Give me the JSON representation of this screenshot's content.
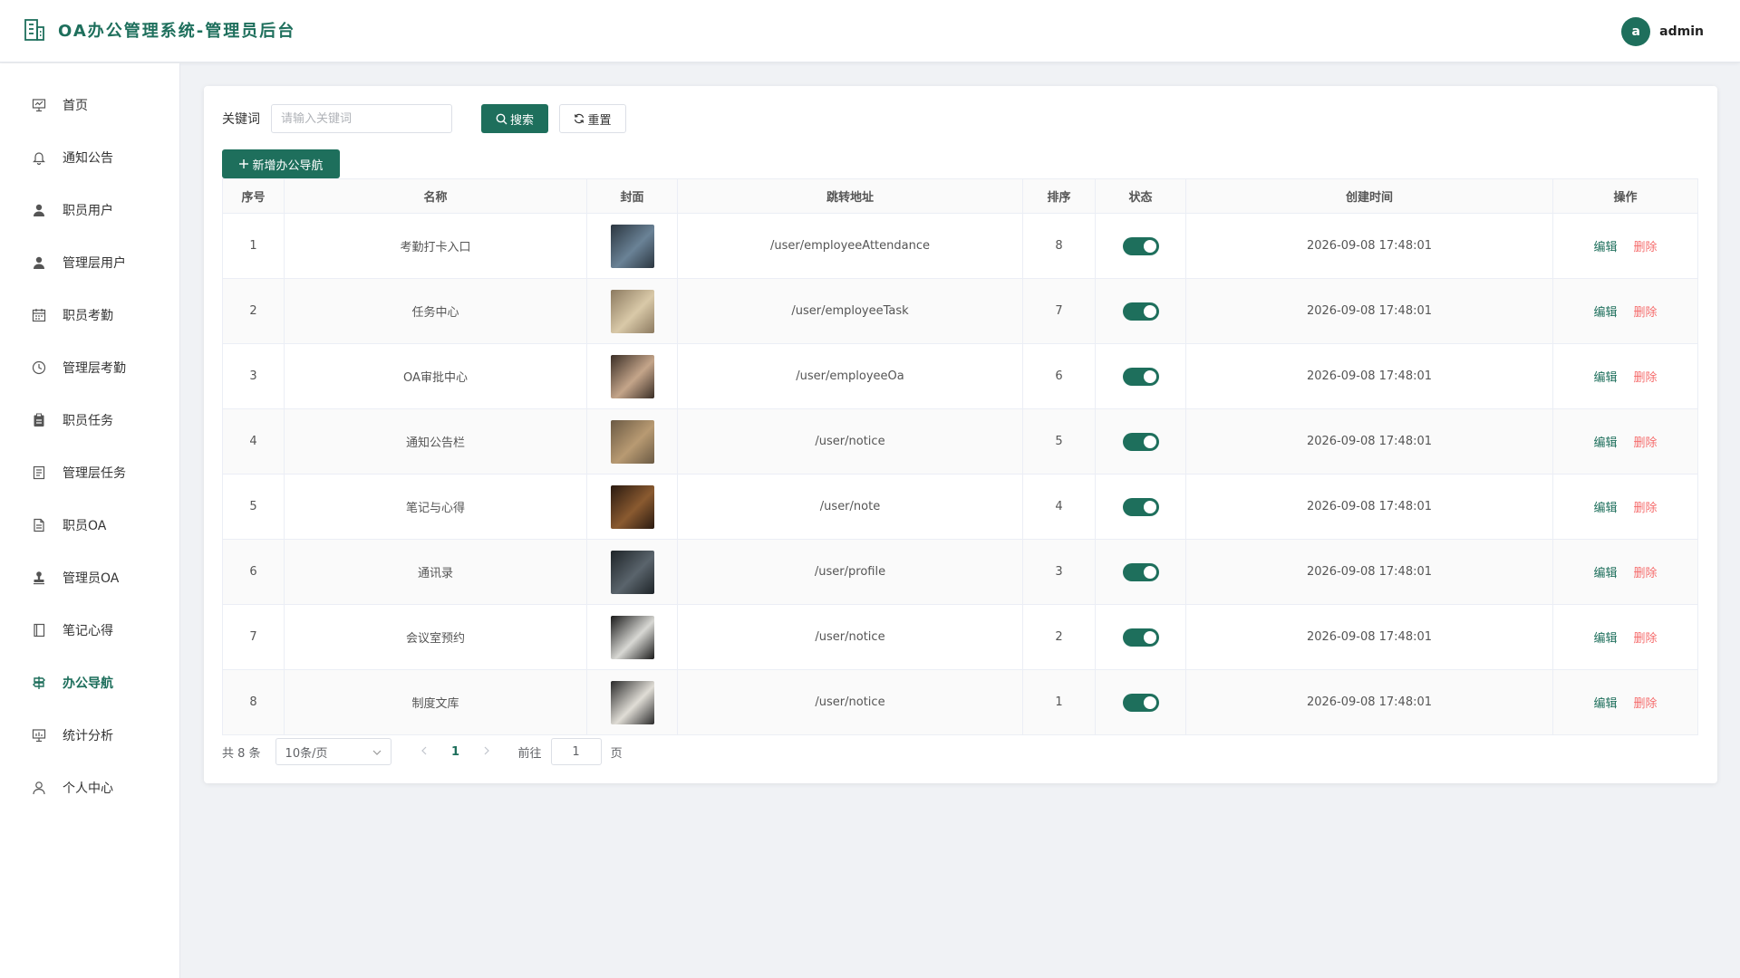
{
  "header": {
    "title": "OA办公管理系统-管理员后台",
    "avatar_letter": "a",
    "username": "admin"
  },
  "sidebar": {
    "items": [
      {
        "label": "首页",
        "icon": "presentation-icon",
        "active": false
      },
      {
        "label": "通知公告",
        "icon": "bell-icon",
        "active": false
      },
      {
        "label": "职员用户",
        "icon": "user-icon",
        "active": false
      },
      {
        "label": "管理层用户",
        "icon": "user-icon",
        "active": false
      },
      {
        "label": "职员考勤",
        "icon": "calendar-icon",
        "active": false
      },
      {
        "label": "管理层考勤",
        "icon": "clock-icon",
        "active": false
      },
      {
        "label": "职员任务",
        "icon": "clipboard-icon",
        "active": false
      },
      {
        "label": "管理层任务",
        "icon": "document-icon",
        "active": false
      },
      {
        "label": "职员OA",
        "icon": "file-icon",
        "active": false
      },
      {
        "label": "管理员OA",
        "icon": "stamp-icon",
        "active": false
      },
      {
        "label": "笔记心得",
        "icon": "notebook-icon",
        "active": false
      },
      {
        "label": "办公导航",
        "icon": "signpost-icon",
        "active": true
      },
      {
        "label": "统计分析",
        "icon": "chart-board-icon",
        "active": false
      },
      {
        "label": "个人中心",
        "icon": "person-outline-icon",
        "active": false
      }
    ]
  },
  "search": {
    "label": "关键词",
    "placeholder": "请输入关键词",
    "search_button": "搜索",
    "reset_button": "重置"
  },
  "toolbar": {
    "add_button": "新增办公导航"
  },
  "table": {
    "headers": [
      "序号",
      "名称",
      "封面",
      "跳转地址",
      "排序",
      "状态",
      "创建时间",
      "操作"
    ],
    "rows": [
      {
        "index": "1",
        "name": "考勤打卡入口",
        "url": "/user/employeeAttendance",
        "sort": "8",
        "status": true,
        "created": "2026-09-08 17:48:01",
        "cover_colors": [
          "#2b3640",
          "#6a8296"
        ]
      },
      {
        "index": "2",
        "name": "任务中心",
        "url": "/user/employeeTask",
        "sort": "7",
        "status": true,
        "created": "2026-09-08 17:48:01",
        "cover_colors": [
          "#8c7a60",
          "#d9c9a8"
        ]
      },
      {
        "index": "3",
        "name": "OA审批中心",
        "url": "/user/employeeOa",
        "sort": "6",
        "status": true,
        "created": "2026-09-08 17:48:01",
        "cover_colors": [
          "#3a2e26",
          "#c4a58a"
        ]
      },
      {
        "index": "4",
        "name": "通知公告栏",
        "url": "/user/notice",
        "sort": "5",
        "status": true,
        "created": "2026-09-08 17:48:01",
        "cover_colors": [
          "#6b5a44",
          "#b89a72"
        ]
      },
      {
        "index": "5",
        "name": "笔记与心得",
        "url": "/user/note",
        "sort": "4",
        "status": true,
        "created": "2026-09-08 17:48:01",
        "cover_colors": [
          "#2a1a10",
          "#8a5a30"
        ]
      },
      {
        "index": "6",
        "name": "通讯录",
        "url": "/user/profile",
        "sort": "3",
        "status": true,
        "created": "2026-09-08 17:48:01",
        "cover_colors": [
          "#1e2428",
          "#5a646c"
        ]
      },
      {
        "index": "7",
        "name": "会议室预约",
        "url": "/user/notice",
        "sort": "2",
        "status": true,
        "created": "2026-09-08 17:48:01",
        "cover_colors": [
          "#1a1a1a",
          "#d8d8d4"
        ]
      },
      {
        "index": "8",
        "name": "制度文库",
        "url": "/user/notice",
        "sort": "1",
        "status": true,
        "created": "2026-09-08 17:48:01",
        "cover_colors": [
          "#2a2a2a",
          "#e0ddd6"
        ]
      }
    ],
    "edit_label": "编辑",
    "delete_label": "删除"
  },
  "pagination": {
    "total_text": "共 8 条",
    "page_size": "10条/页",
    "current_page": "1",
    "goto_label": "前往",
    "goto_value": "1",
    "page_unit": "页"
  },
  "colors": {
    "primary": "#1e6f5c",
    "danger": "#f56c6c"
  }
}
